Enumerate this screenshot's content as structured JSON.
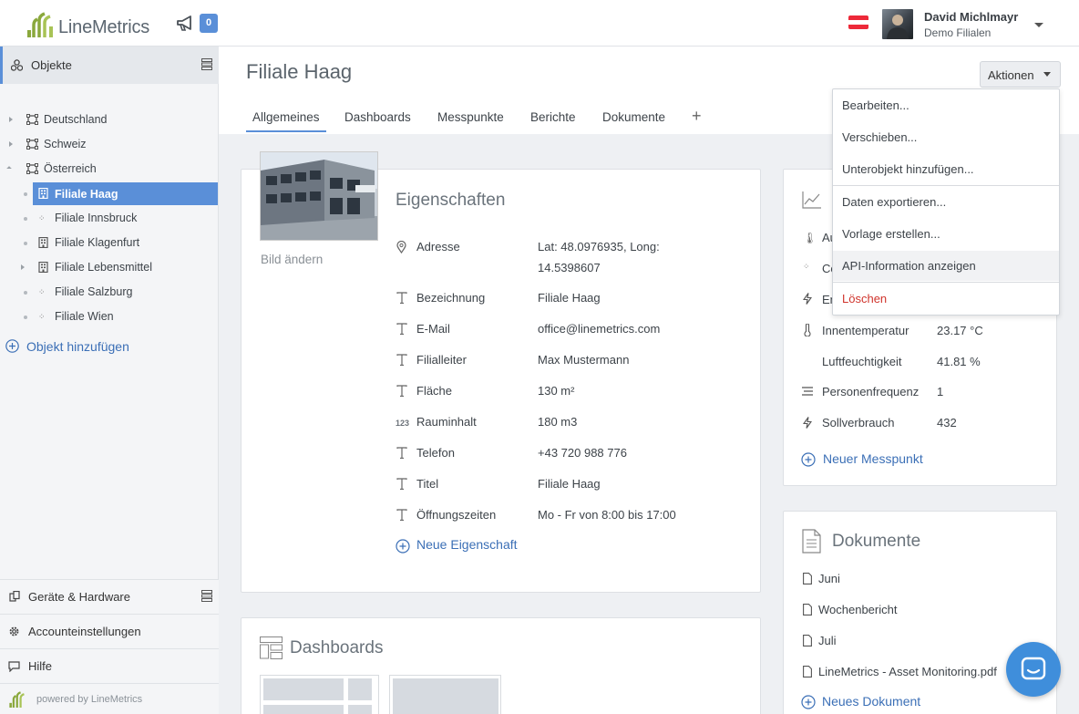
{
  "header": {
    "logo_text": "LineMetrics",
    "notifications_count": "0",
    "user_name": "David Michlmayr",
    "user_org": "Demo Filialen",
    "flag_colors": [
      "#ed2939",
      "#ffffff",
      "#ed2939"
    ]
  },
  "sidebar": {
    "objects_label": "Objekte",
    "tree": [
      {
        "label": "Deutschland",
        "level": 0,
        "icon": "region-icon",
        "expandable": true,
        "expanded": false
      },
      {
        "label": "Schweiz",
        "level": 0,
        "icon": "region-icon",
        "expandable": true,
        "expanded": false
      },
      {
        "label": "Österreich",
        "level": 0,
        "icon": "region-icon",
        "expandable": true,
        "expanded": true
      },
      {
        "label": "Filiale Haag",
        "level": 1,
        "icon": "building-icon",
        "selected": true
      },
      {
        "label": "Filiale Innsbruck",
        "level": 1,
        "icon": "scatter-icon"
      },
      {
        "label": "Filiale Klagenfurt",
        "level": 1,
        "icon": "building-icon"
      },
      {
        "label": "Filiale Lebensmittel",
        "level": 1,
        "icon": "building-icon",
        "expandable": true
      },
      {
        "label": "Filiale Salzburg",
        "level": 1,
        "icon": "scatter-icon"
      },
      {
        "label": "Filiale Wien",
        "level": 1,
        "icon": "scatter-icon"
      }
    ],
    "add_object": "Objekt hinzufügen",
    "bottom": {
      "devices": "Geräte & Hardware",
      "account": "Accounteinstellungen",
      "help": "Hilfe",
      "powered": "powered by LineMetrics"
    }
  },
  "page": {
    "title": "Filiale Haag",
    "tabs": [
      "Allgemeines",
      "Dashboards",
      "Messpunkte",
      "Berichte",
      "Dokumente"
    ],
    "tab_add": "+",
    "actions_label": "Aktionen"
  },
  "actions_menu": [
    "Bearbeiten...",
    "Verschieben...",
    "Unterobjekt hinzufügen...",
    "Daten exportieren...",
    "Vorlage erstellen...",
    "API-Information anzeigen",
    "Löschen"
  ],
  "properties": {
    "change_image": "Bild ändern",
    "title": "Eigenschaften",
    "rows": [
      {
        "label": "Adresse",
        "value": "Lat: 48.0976935, Long:",
        "value2": "14.5398607",
        "icon": "location-icon"
      },
      {
        "label": "Bezeichnung",
        "value": "Filiale Haag",
        "icon": "text-icon"
      },
      {
        "label": "E-Mail",
        "value": "office@linemetrics.com",
        "icon": "text-icon"
      },
      {
        "label": "Filialleiter",
        "value": "Max Mustermann",
        "icon": "text-icon"
      },
      {
        "label": "Fläche",
        "value": "130 m²",
        "icon": "text-icon"
      },
      {
        "label": "Rauminhalt",
        "value": "180 m3",
        "icon": "number-icon"
      },
      {
        "label": "Telefon",
        "value": "+43 720 988 776",
        "icon": "text-icon"
      },
      {
        "label": "Titel",
        "value": "Filiale Haag",
        "icon": "text-icon"
      },
      {
        "label": "Öffnungszeiten",
        "value": "Mo - Fr von 8:00 bis 17:00",
        "icon": "text-icon"
      }
    ],
    "add_property": "Neue Eigenschaft"
  },
  "measurements": {
    "partial_labels": [
      "Au",
      "Co",
      "En"
    ],
    "rows": [
      {
        "label": "Innentemperatur",
        "value": "23.17 °C",
        "icon": "thermometer-icon"
      },
      {
        "label": "Luftfeuchtigkeit",
        "value": "41.81 %",
        "icon": ""
      },
      {
        "label": "Personenfrequenz",
        "value": "1",
        "icon": "lines-icon"
      },
      {
        "label": "Sollverbrauch",
        "value": "432",
        "icon": "bolt-icon"
      }
    ],
    "add_measurement": "Neuer Messpunkt"
  },
  "dashboards": {
    "title": "Dashboards"
  },
  "documents": {
    "title": "Dokumente",
    "items": [
      "Juni",
      "Wochenbericht",
      "Juli",
      "LineMetrics - Asset Monitoring.pdf"
    ],
    "add_document": "Neues Dokument"
  }
}
